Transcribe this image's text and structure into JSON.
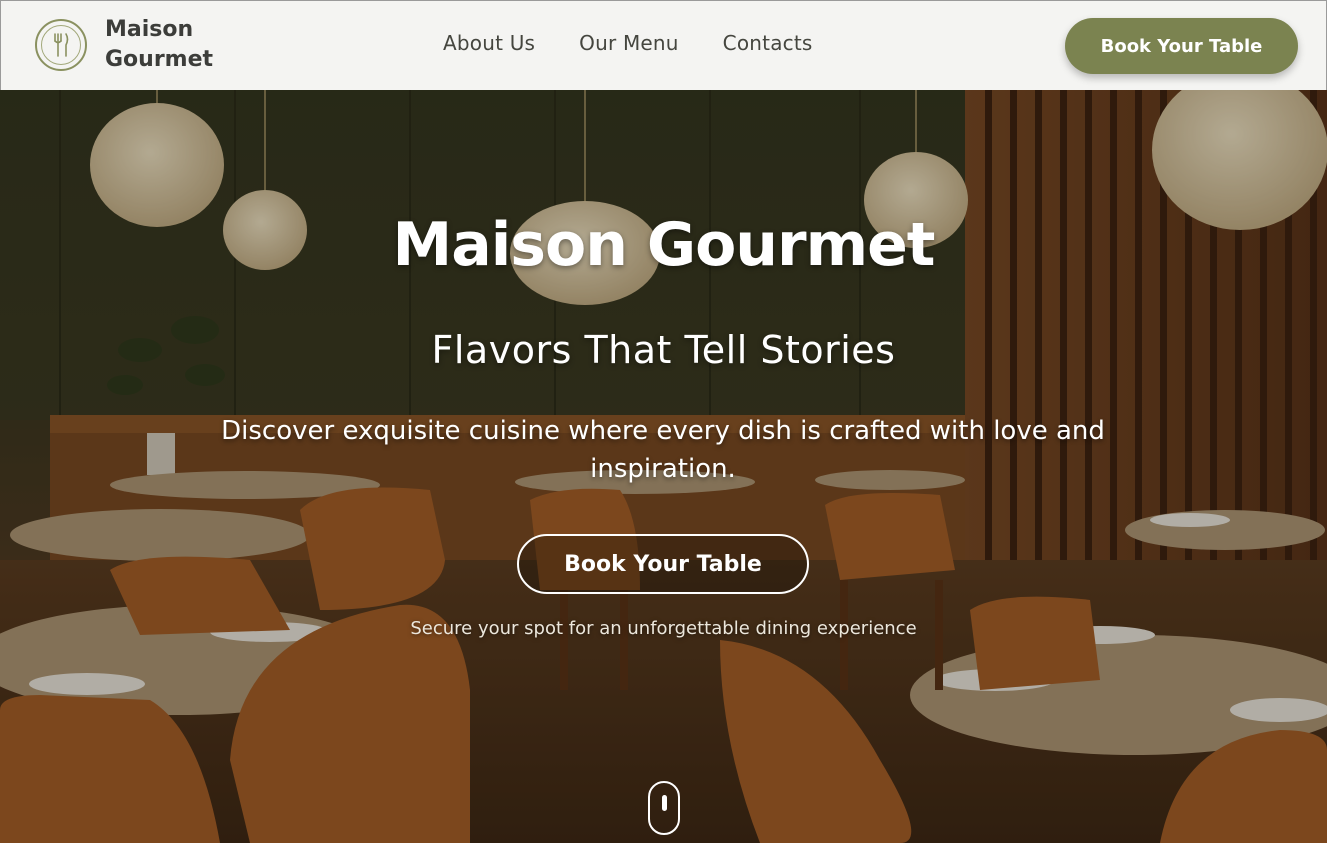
{
  "header": {
    "brand_name": "Maison Gourmet",
    "logo_icon": "fork-knife-icon",
    "nav": [
      {
        "label": "About Us"
      },
      {
        "label": "Our Menu"
      },
      {
        "label": "Contacts"
      }
    ],
    "cta_label": "Book Your Table"
  },
  "hero": {
    "title": "Maison Gourmet",
    "subtitle": "Flavors That Tell Stories",
    "description": "Discover exquisite cuisine where every dish is crafted with love and inspiration.",
    "cta_label": "Book Your Table",
    "note": "Secure your spot for an unforgettable dining experience",
    "scroll_icon": "mouse-scroll-icon"
  },
  "colors": {
    "accent": "#7b8350",
    "header_bg": "#f4f4f2",
    "brand_text": "#3c3d3a"
  }
}
